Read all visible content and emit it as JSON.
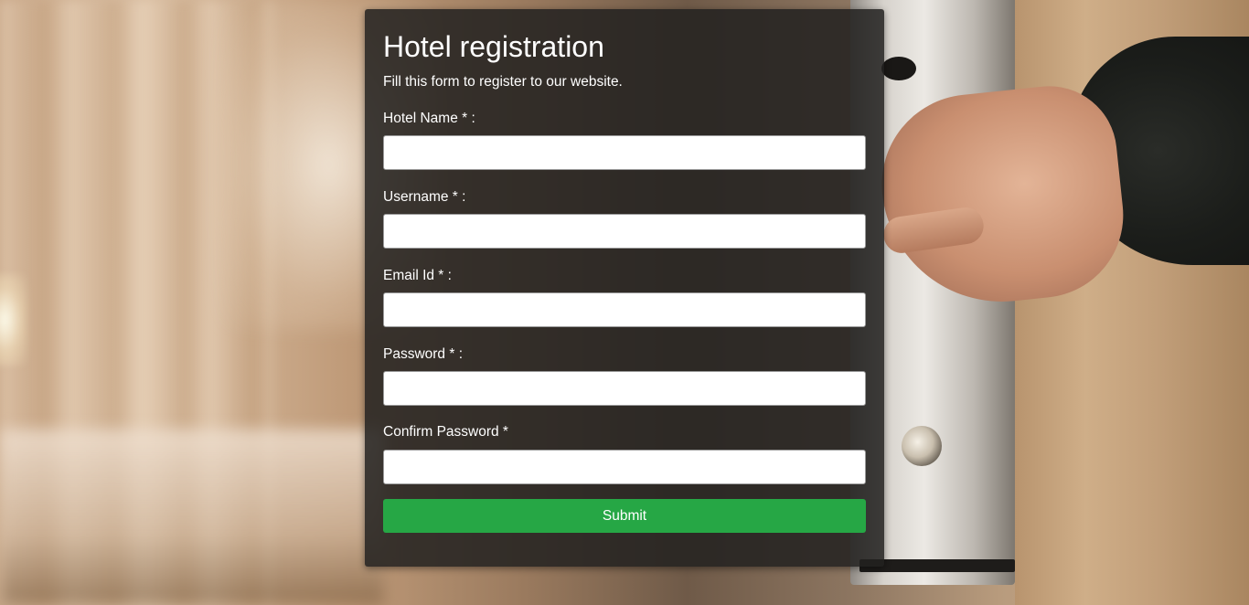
{
  "form": {
    "title": "Hotel registration",
    "subtitle": "Fill this form to register to our website.",
    "fields": [
      {
        "label": "Hotel Name * :",
        "value": "",
        "placeholder": ""
      },
      {
        "label": "Username * :",
        "value": "",
        "placeholder": ""
      },
      {
        "label": "Email Id * :",
        "value": "",
        "placeholder": ""
      },
      {
        "label": "Password * :",
        "value": "",
        "placeholder": ""
      },
      {
        "label": "Confirm Password *",
        "value": "",
        "placeholder": ""
      }
    ],
    "submit_label": "Submit"
  },
  "colors": {
    "card_background": "#222120",
    "submit_button": "#26a745",
    "text": "#ffffff"
  }
}
